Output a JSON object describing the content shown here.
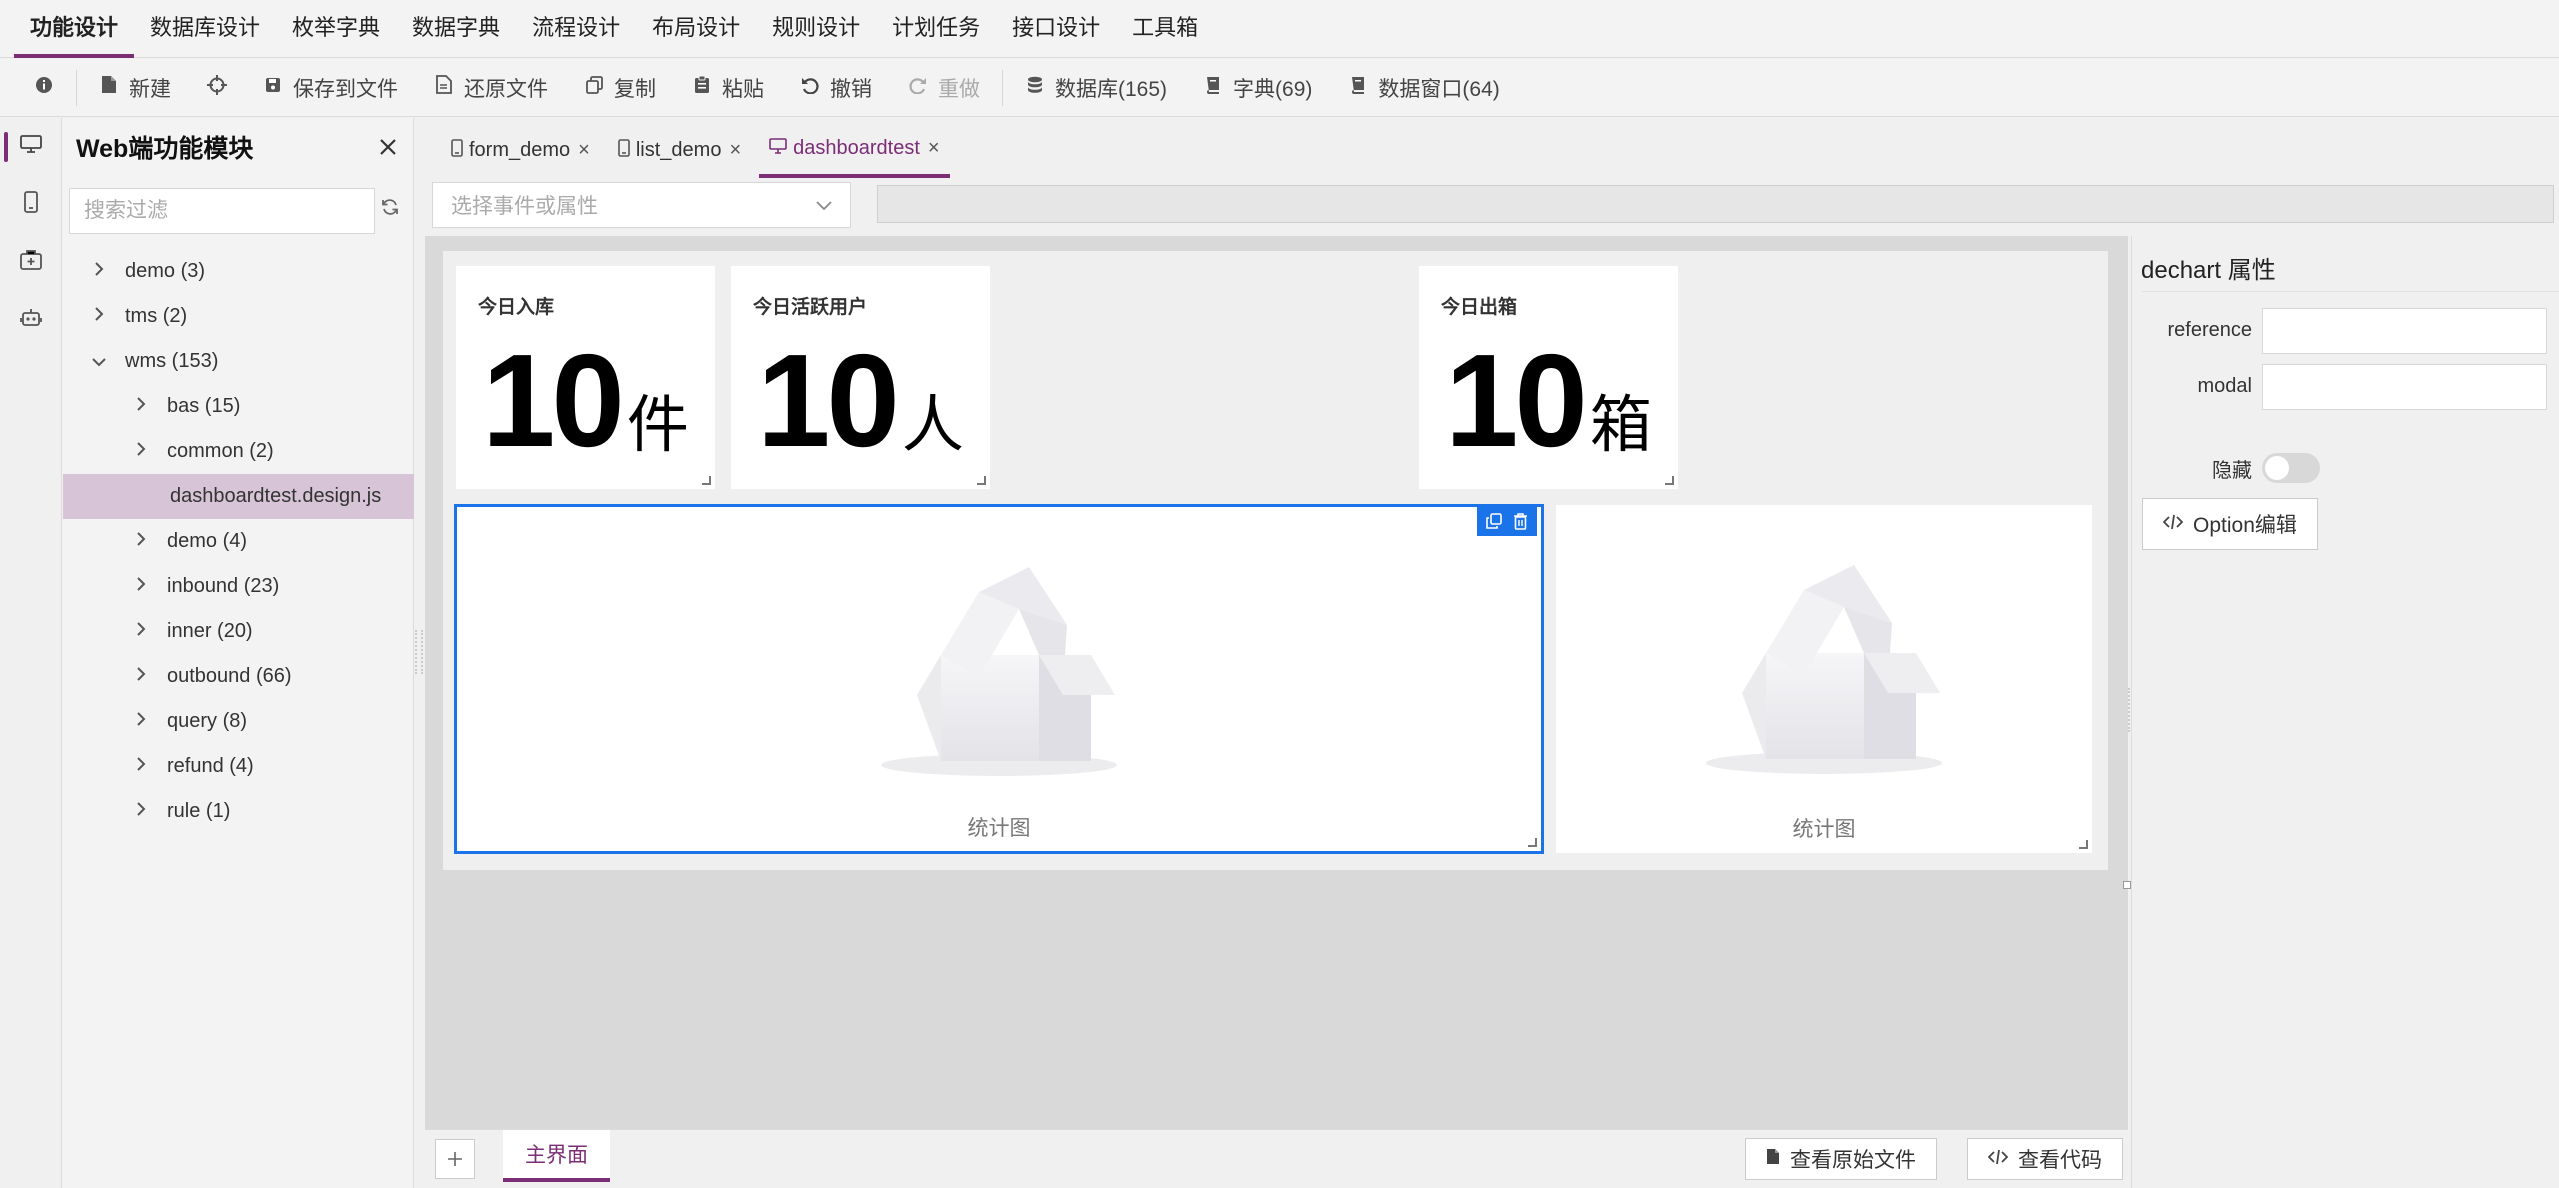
{
  "menu": {
    "items": [
      {
        "label": "功能设计",
        "active": true
      },
      {
        "label": "数据库设计"
      },
      {
        "label": "枚举字典"
      },
      {
        "label": "数据字典"
      },
      {
        "label": "流程设计"
      },
      {
        "label": "布局设计"
      },
      {
        "label": "规则设计"
      },
      {
        "label": "计划任务"
      },
      {
        "label": "接口设计"
      },
      {
        "label": "工具箱"
      }
    ]
  },
  "toolbar": {
    "new": "新建",
    "save": "保存到文件",
    "restore": "还原文件",
    "copy": "复制",
    "paste": "粘贴",
    "undo": "撤销",
    "redo": "重做",
    "database": "数据库(165)",
    "dictionary": "字典(69)",
    "data_window": "数据窗口(64)"
  },
  "left_panel": {
    "title": "Web端功能模块",
    "search_placeholder": "搜索过滤",
    "tree": {
      "demo": "demo (3)",
      "tms": "tms (2)",
      "wms": "wms (153)",
      "bas": "bas (15)",
      "common": "common (2)",
      "dashboardtest": "dashboardtest.design.js",
      "wms_demo": "demo (4)",
      "inbound": "inbound (23)",
      "inner": "inner (20)",
      "outbound": "outbound (66)",
      "query": "query (8)",
      "refund": "refund (4)",
      "rule": "rule (1)"
    }
  },
  "doc_tabs": {
    "form_demo": "form_demo",
    "list_demo": "list_demo",
    "dashboardtest": "dashboardtest"
  },
  "event_select": {
    "placeholder": "选择事件或属性"
  },
  "dashboard": {
    "stat1": {
      "title": "今日入库",
      "value": "10",
      "unit": "件"
    },
    "stat2": {
      "title": "今日活跃用户",
      "value": "10",
      "unit": "人"
    },
    "stat3": {
      "title": "今日出箱",
      "value": "10",
      "unit": "箱"
    },
    "chart1_label": "统计图",
    "chart2_label": "统计图"
  },
  "bottom": {
    "page_tab": "主界面",
    "view_source": "查看原始文件",
    "view_code": "查看代码"
  },
  "props": {
    "title": "dechart 属性",
    "reference_label": "reference",
    "modal_label": "modal",
    "hidden_label": "隐藏",
    "hidden_value": false,
    "option_edit": "Option编辑"
  },
  "colors": {
    "accent": "#7b2d75",
    "selection": "#1a73e8"
  }
}
